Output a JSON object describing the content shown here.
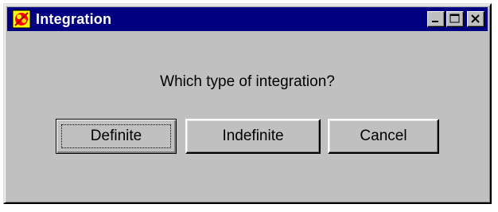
{
  "window": {
    "title": "Integration",
    "icon": "app-icon",
    "controls": {
      "minimize": "minimize-icon",
      "maximize": "maximize-icon",
      "close": "close-icon"
    }
  },
  "dialog": {
    "prompt": "Which type of integration?",
    "buttons": {
      "definite": "Definite",
      "indefinite": "Indefinite",
      "cancel": "Cancel"
    },
    "default_button": "definite"
  },
  "colors": {
    "titlebar": "#000080",
    "face": "#c0c0c0"
  }
}
